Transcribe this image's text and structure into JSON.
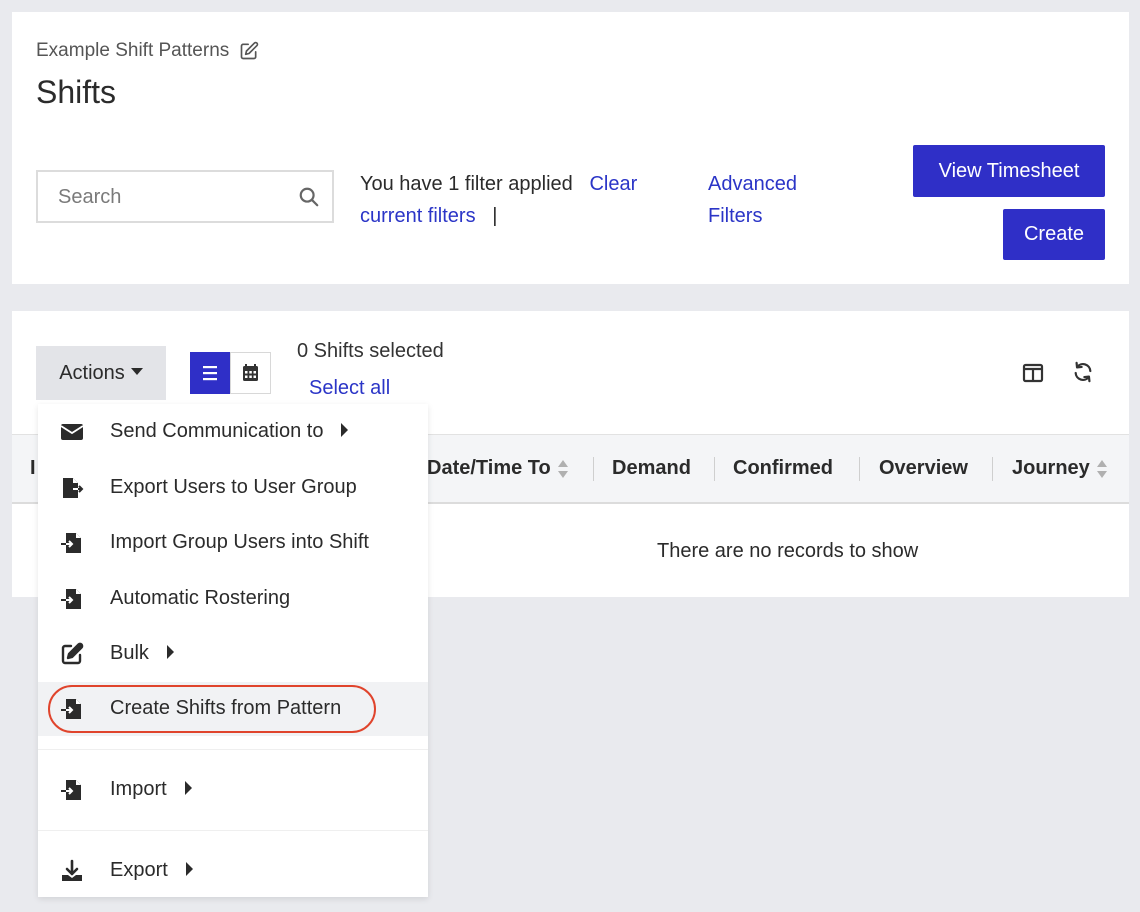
{
  "header": {
    "breadcrumb": "Example Shift Patterns",
    "title": "Shifts"
  },
  "search": {
    "placeholder": "Search"
  },
  "filters": {
    "applied_text": "You have 1 filter applied",
    "clear_link": "Clear current filters",
    "separator": "|",
    "advanced_link": "Advanced Filters"
  },
  "buttons": {
    "view_timesheet": "View Timesheet",
    "create": "Create",
    "actions": "Actions"
  },
  "selection": {
    "count_text": "0 Shifts selected",
    "select_all": "Select all"
  },
  "table": {
    "columns": [
      "I",
      "Date/Time To",
      "Demand",
      "Confirmed",
      "Overview",
      "Journey"
    ],
    "empty_message": "There are no records to show"
  },
  "actions_menu": {
    "items": [
      {
        "label": "Send Communication to",
        "icon": "envelope-icon",
        "submenu": true
      },
      {
        "label": "Export Users to User Group",
        "icon": "file-export-icon",
        "submenu": false
      },
      {
        "label": "Import Group Users into Shift",
        "icon": "file-import-icon",
        "submenu": false
      },
      {
        "label": "Automatic Rostering",
        "icon": "file-import-icon",
        "submenu": false
      },
      {
        "label": "Bulk",
        "icon": "edit-icon",
        "submenu": true
      },
      {
        "label": "Create Shifts from Pattern",
        "icon": "file-import-icon",
        "submenu": false,
        "highlighted": true
      },
      {
        "label": "Import",
        "icon": "file-import-icon",
        "submenu": true
      },
      {
        "label": "Export",
        "icon": "download-icon",
        "submenu": true
      }
    ]
  },
  "colors": {
    "primary": "#2f2fc7",
    "link": "#2b35c7",
    "highlight_ring": "#e0442c",
    "page_bg": "#e9eaee"
  }
}
